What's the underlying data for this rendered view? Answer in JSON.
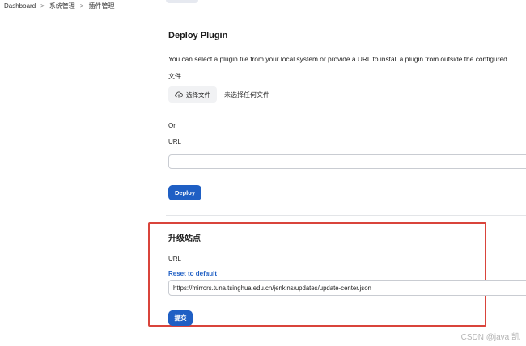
{
  "breadcrumb": {
    "items": [
      "Dashboard",
      "系统管理",
      "插件管理"
    ],
    "separator": ">"
  },
  "deploy": {
    "title": "Deploy Plugin",
    "description": "You can select a plugin file from your local system or provide a URL to install a plugin from outside the configured",
    "file_label": "文件",
    "choose_file_button": "选择文件",
    "no_file_text": "未选择任何文件",
    "or_text": "Or",
    "url_label": "URL",
    "url_value": "",
    "deploy_button": "Deploy"
  },
  "upgrade_site": {
    "title": "升级站点",
    "url_label": "URL",
    "reset_link": "Reset to default",
    "url_value": "https://mirrors.tuna.tsinghua.edu.cn/jenkins/updates/update-center.json",
    "submit_button": "提交"
  },
  "watermark": "CSDN @java 凯",
  "colors": {
    "primary": "#1f5fc4",
    "highlight_border": "#d9443b"
  }
}
